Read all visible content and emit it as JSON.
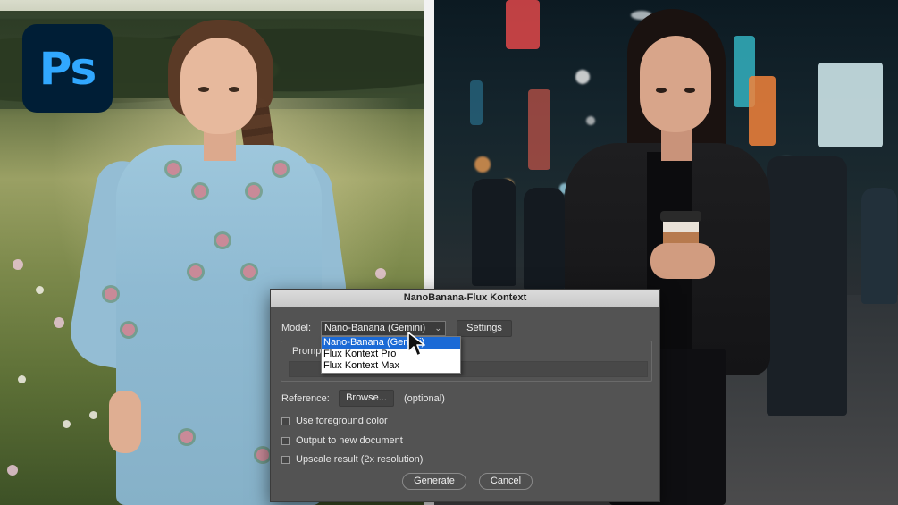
{
  "logo": {
    "text": "Ps"
  },
  "dialog": {
    "title": "NanoBanana-Flux Kontext",
    "model_label": "Model:",
    "model_selected": "Nano-Banana (Gemini)",
    "settings_button": "Settings",
    "model_options": [
      "Nano-Banana (Gemini)",
      "Flux Kontext Pro",
      "Flux Kontext Max"
    ],
    "prompt_label": "Prompt",
    "reference_label": "Reference:",
    "browse_button": "Browse...",
    "optional_text": "(optional)",
    "checkboxes": [
      {
        "label": "Use foreground color",
        "checked": false
      },
      {
        "label": "Output to new document",
        "checked": false
      },
      {
        "label": "Upscale result (2x resolution)",
        "checked": false
      }
    ],
    "generate_button": "Generate",
    "cancel_button": "Cancel"
  },
  "colors": {
    "ps_bg": "#001e36",
    "ps_text": "#31a8ff",
    "dialog_bg": "#535353",
    "selection": "#1b6ad6"
  },
  "icons": {
    "cursor": "mouse-pointer-icon",
    "dropdown": "chevron-down-icon"
  }
}
